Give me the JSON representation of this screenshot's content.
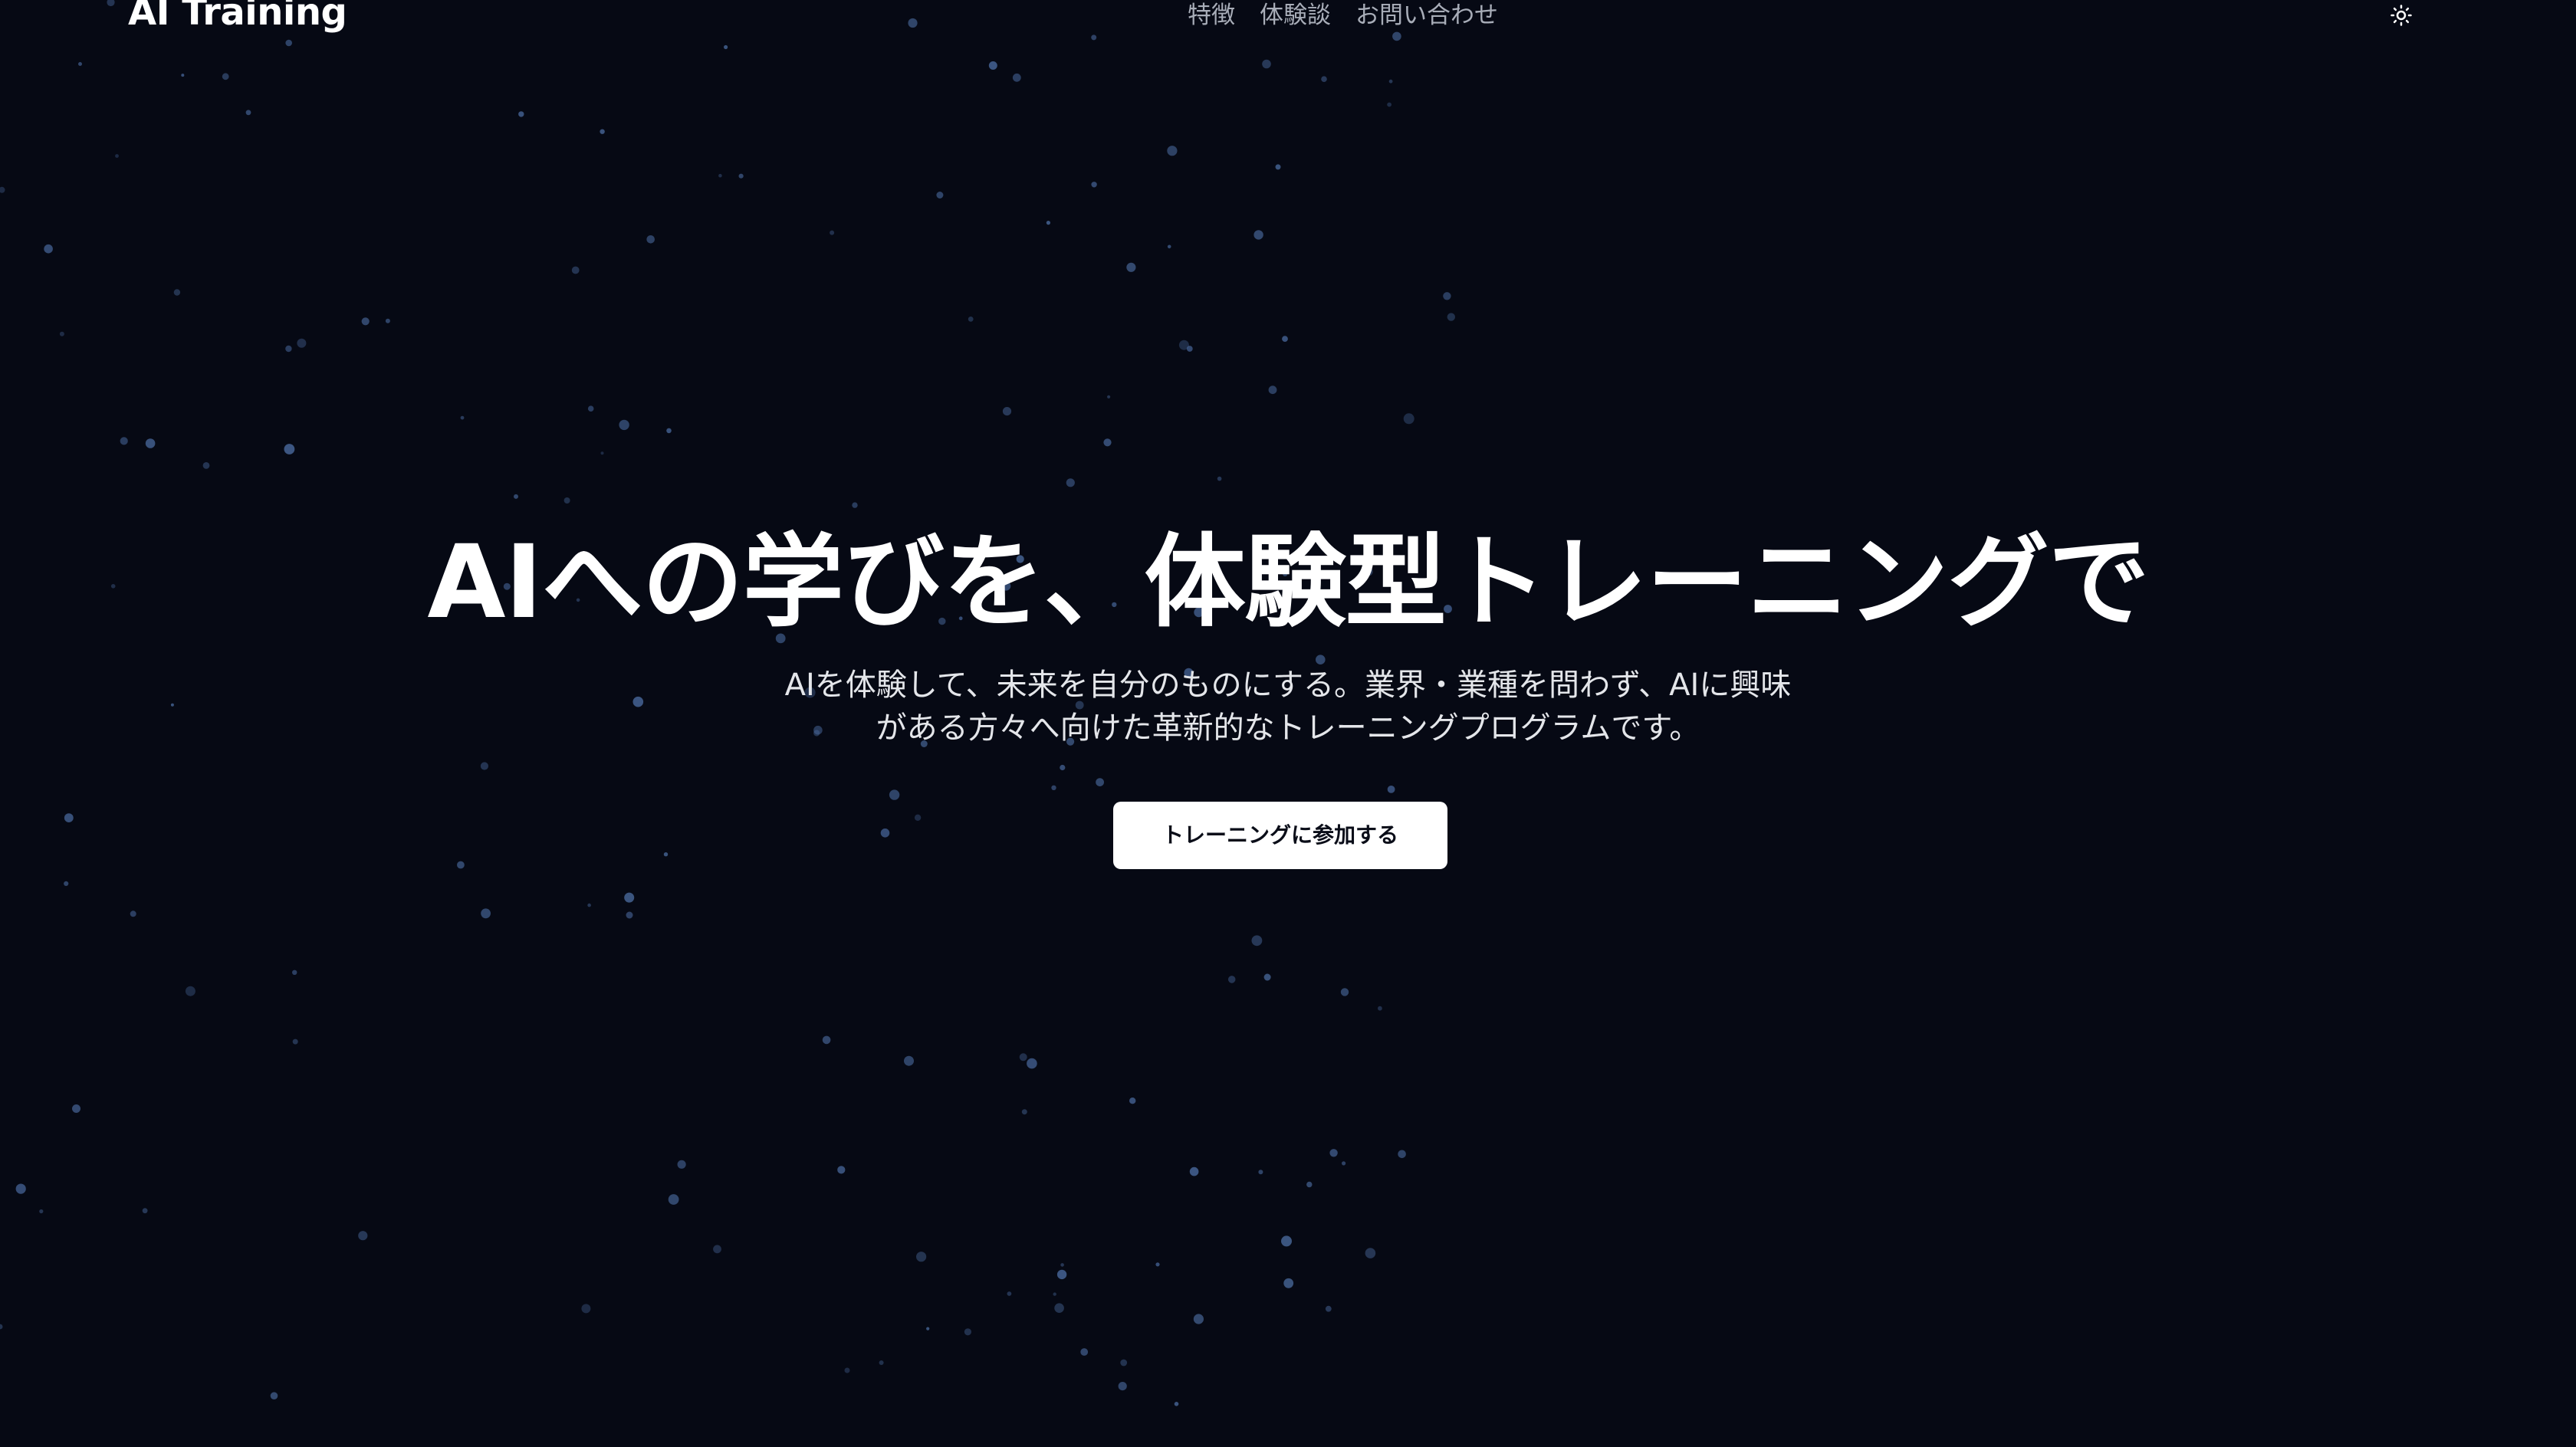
{
  "header": {
    "logo": "AI Training",
    "nav": [
      {
        "label": "特徴"
      },
      {
        "label": "体験談"
      },
      {
        "label": "お問い合わせ"
      }
    ],
    "theme_toggle_icon": "sun-icon"
  },
  "hero": {
    "title": "AIへの学びを、体験型トレーニングで",
    "subtitle_lines": [
      "AIを体験して、未来を自分のものにする。業界・業種を問わず、AIに興味",
      "がある方々へ向けた革新的なトレーニングプログラムです。"
    ],
    "cta_label": "トレーニングに参加する"
  },
  "colors": {
    "background": "#060914",
    "star": "#4a6a9e",
    "nav_text": "#a8adb8",
    "cta_background": "#ffffff",
    "cta_text": "#0a0d18"
  }
}
